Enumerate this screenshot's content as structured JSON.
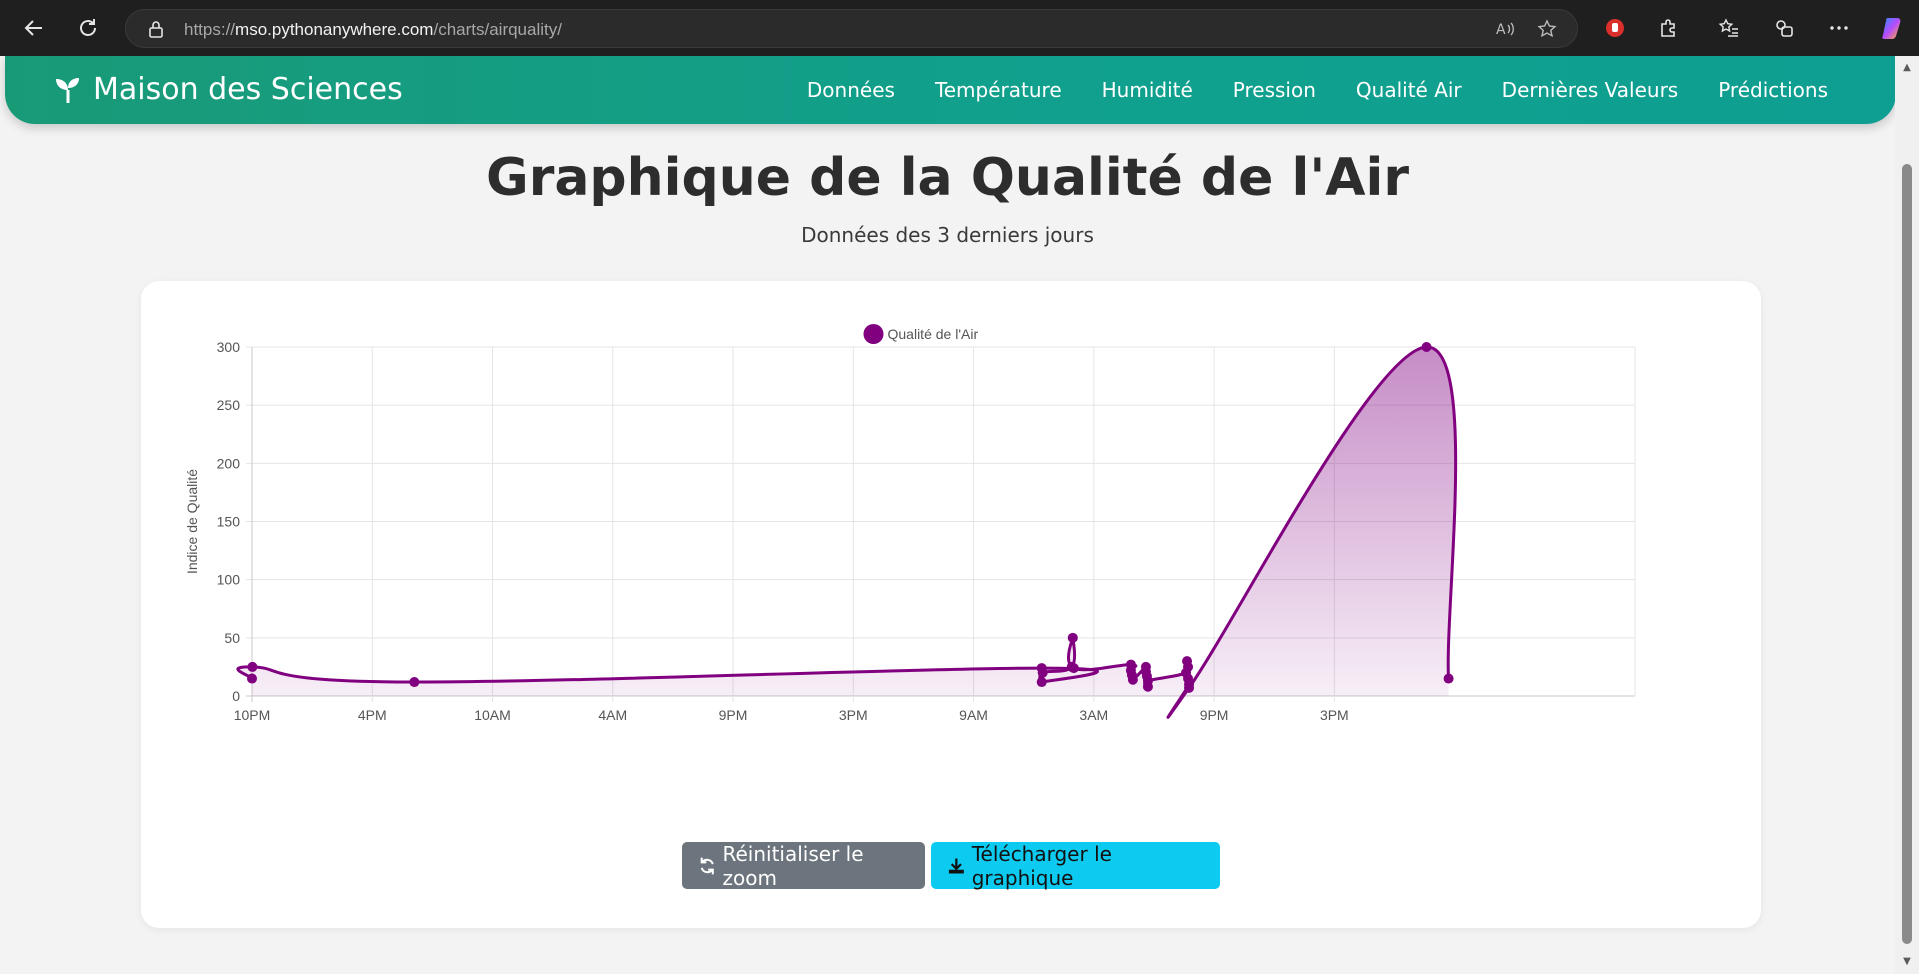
{
  "browser": {
    "url_scheme": "https://",
    "url_host": "mso.pythonanywhere.com",
    "url_path": "/charts/airquality/"
  },
  "navbar": {
    "brand": "Maison des Sciences",
    "links": [
      "Données",
      "Température",
      "Humidité",
      "Pression",
      "Qualité Air",
      "Dernières Valeurs",
      "Prédictions"
    ]
  },
  "page": {
    "title": "Graphique de la Qualité de l'Air",
    "subtitle": "Données des 3 derniers jours"
  },
  "buttons": {
    "reset_zoom": "Réinitialiser le zoom",
    "download": "Télécharger le graphique"
  },
  "colors": {
    "series": "#800080",
    "navbar": "#13a07f",
    "reset_button": "#6c757d",
    "download_button": "#0dcaf0"
  },
  "chart_data": {
    "type": "line",
    "title": "",
    "legend": [
      "Qualité de l'Air"
    ],
    "legend_position": "top",
    "xlabel": "",
    "ylabel": "Indice de Qualité",
    "ylim": [
      0,
      300
    ],
    "yticks": [
      0,
      50,
      100,
      150,
      200,
      250,
      300
    ],
    "xticks": [
      "10PM",
      "4PM",
      "10AM",
      "4AM",
      "9PM",
      "3PM",
      "9AM",
      "3AM",
      "9PM",
      "3PM"
    ],
    "grid": true,
    "fill": true,
    "series": [
      {
        "name": "Qualité de l'Air",
        "points": [
          {
            "x": 0.0,
            "y": 15
          },
          {
            "x": 0.02,
            "y": 25
          },
          {
            "x": 8.1,
            "y": 12
          },
          {
            "x": 39.4,
            "y": 24
          },
          {
            "x": 39.4,
            "y": 12
          },
          {
            "x": 39.45,
            "y": 20
          },
          {
            "x": 40.9,
            "y": 25
          },
          {
            "x": 40.95,
            "y": 50
          },
          {
            "x": 41.0,
            "y": 24
          },
          {
            "x": 43.85,
            "y": 27
          },
          {
            "x": 43.85,
            "y": 22
          },
          {
            "x": 43.9,
            "y": 18
          },
          {
            "x": 43.95,
            "y": 14
          },
          {
            "x": 44.6,
            "y": 25
          },
          {
            "x": 44.6,
            "y": 21
          },
          {
            "x": 44.65,
            "y": 17
          },
          {
            "x": 44.7,
            "y": 8
          },
          {
            "x": 44.7,
            "y": 13
          },
          {
            "x": 46.6,
            "y": 20
          },
          {
            "x": 46.65,
            "y": 30
          },
          {
            "x": 46.7,
            "y": 25
          },
          {
            "x": 46.7,
            "y": 15
          },
          {
            "x": 46.75,
            "y": 10
          },
          {
            "x": 46.75,
            "y": 7
          },
          {
            "x": 58.6,
            "y": 300
          },
          {
            "x": 59.7,
            "y": 15
          }
        ]
      }
    ]
  }
}
